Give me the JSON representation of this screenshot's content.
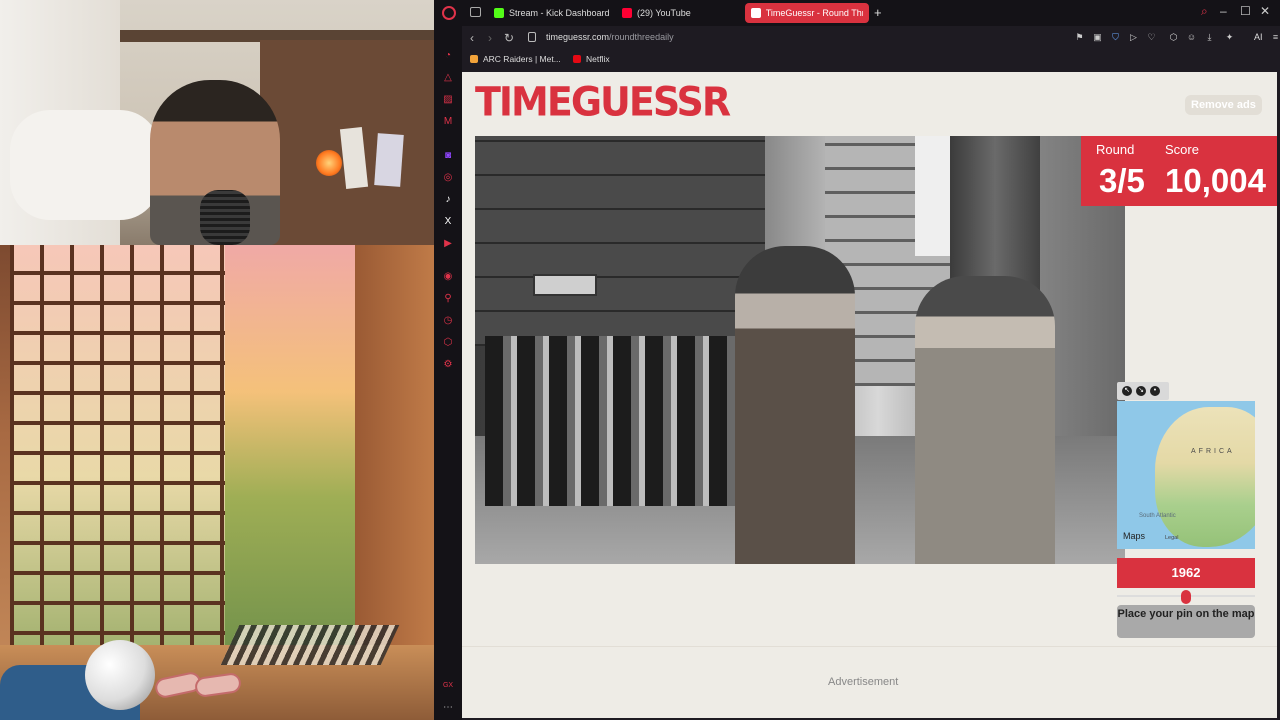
{
  "browser": {
    "tabs": [
      {
        "label": "Stream - Kick Dashboard",
        "color": "#53fc18"
      },
      {
        "label": "(29) YouTube",
        "color": "#ff0033"
      },
      {
        "label": "TimeGuessr - Round Thre",
        "color": "#ffffff"
      }
    ],
    "url": {
      "host": "timeguessr.com",
      "path": "/roundthreedaily"
    },
    "bookmarks": [
      {
        "label": "ARC Raiders | Met...",
        "color": "#f2a33a"
      },
      {
        "label": "Netflix",
        "color": "#e50914"
      }
    ],
    "ai_label": "AI"
  },
  "page": {
    "brand": "TIMEGUESSR",
    "remove_ads": "Remove ads",
    "score": {
      "round_label": "Round",
      "round_value": "3/5",
      "score_label": "Score",
      "score_value": "10,004"
    },
    "map": {
      "continent_label": "AFRICA",
      "ocean_label": "South Atlantic",
      "attribution": "Maps",
      "legal": "Legal"
    },
    "year": {
      "value": "1962",
      "slider_fraction": 0.5
    },
    "pin_button": "Place your pin on the map",
    "advertisement": "Advertisement"
  },
  "colors": {
    "accent": "#d9323f",
    "page_bg": "#eeece6"
  }
}
